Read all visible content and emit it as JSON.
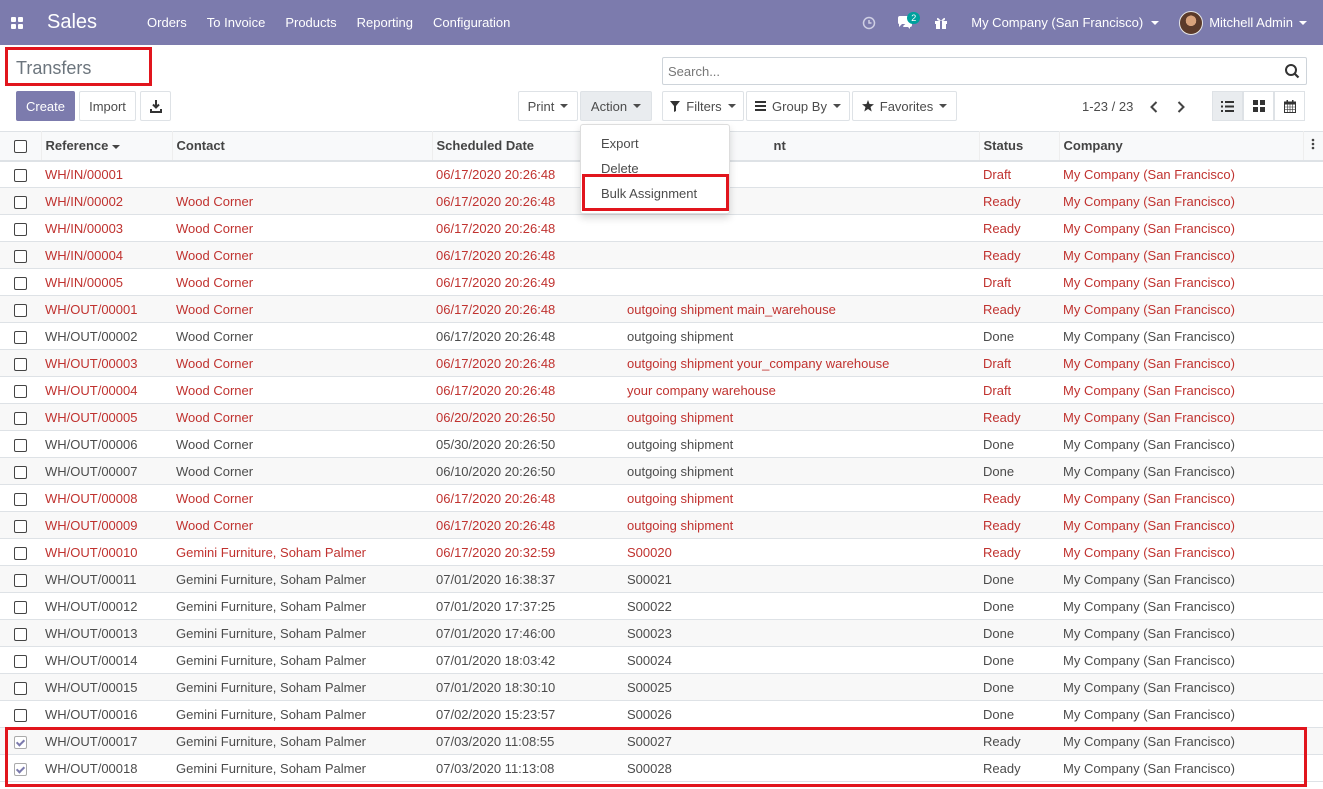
{
  "navbar": {
    "brand": "Sales",
    "menu": [
      "Orders",
      "To Invoice",
      "Products",
      "Reporting",
      "Configuration"
    ],
    "messages_badge": "2",
    "company": "My Company (San Francisco)",
    "user": "Mitchell Admin"
  },
  "control_panel": {
    "title": "Transfers",
    "create_label": "Create",
    "import_label": "Import",
    "print_label": "Print",
    "action_label": "Action",
    "filters_label": "Filters",
    "groupby_label": "Group By",
    "favorites_label": "Favorites",
    "search_placeholder": "Search...",
    "pager_value": "1-23 / 23"
  },
  "action_menu": {
    "items": [
      "Export",
      "Delete",
      "Bulk Assignment"
    ]
  },
  "table": {
    "headers": [
      "Reference",
      "Contact",
      "Scheduled Date",
      "Source Document",
      "Status",
      "Company"
    ],
    "header_overlap_visible": "nt",
    "rows": [
      {
        "ref": "WH/IN/00001",
        "contact": "",
        "date": "06/17/2020 20:26:48",
        "source": "",
        "status": "Draft",
        "company": "My Company (San Francisco)",
        "red": true,
        "checked": false
      },
      {
        "ref": "WH/IN/00002",
        "contact": "Wood Corner",
        "date": "06/17/2020 20:26:48",
        "source": "",
        "status": "Ready",
        "company": "My Company (San Francisco)",
        "red": true,
        "checked": false
      },
      {
        "ref": "WH/IN/00003",
        "contact": "Wood Corner",
        "date": "06/17/2020 20:26:48",
        "source": "",
        "status": "Ready",
        "company": "My Company (San Francisco)",
        "red": true,
        "checked": false
      },
      {
        "ref": "WH/IN/00004",
        "contact": "Wood Corner",
        "date": "06/17/2020 20:26:48",
        "source": "",
        "status": "Ready",
        "company": "My Company (San Francisco)",
        "red": true,
        "checked": false
      },
      {
        "ref": "WH/IN/00005",
        "contact": "Wood Corner",
        "date": "06/17/2020 20:26:49",
        "source": "",
        "status": "Draft",
        "company": "My Company (San Francisco)",
        "red": true,
        "checked": false
      },
      {
        "ref": "WH/OUT/00001",
        "contact": "Wood Corner",
        "date": "06/17/2020 20:26:48",
        "source": "outgoing shipment main_warehouse",
        "status": "Ready",
        "company": "My Company (San Francisco)",
        "red": true,
        "checked": false
      },
      {
        "ref": "WH/OUT/00002",
        "contact": "Wood Corner",
        "date": "06/17/2020 20:26:48",
        "source": "outgoing shipment",
        "status": "Done",
        "company": "My Company (San Francisco)",
        "red": false,
        "checked": false
      },
      {
        "ref": "WH/OUT/00003",
        "contact": "Wood Corner",
        "date": "06/17/2020 20:26:48",
        "source": "outgoing shipment your_company warehouse",
        "status": "Draft",
        "company": "My Company (San Francisco)",
        "red": true,
        "checked": false
      },
      {
        "ref": "WH/OUT/00004",
        "contact": "Wood Corner",
        "date": "06/17/2020 20:26:48",
        "source": "your company warehouse",
        "status": "Draft",
        "company": "My Company (San Francisco)",
        "red": true,
        "checked": false
      },
      {
        "ref": "WH/OUT/00005",
        "contact": "Wood Corner",
        "date": "06/20/2020 20:26:50",
        "source": "outgoing shipment",
        "status": "Ready",
        "company": "My Company (San Francisco)",
        "red": true,
        "checked": false
      },
      {
        "ref": "WH/OUT/00006",
        "contact": "Wood Corner",
        "date": "05/30/2020 20:26:50",
        "source": "outgoing shipment",
        "status": "Done",
        "company": "My Company (San Francisco)",
        "red": false,
        "checked": false
      },
      {
        "ref": "WH/OUT/00007",
        "contact": "Wood Corner",
        "date": "06/10/2020 20:26:50",
        "source": "outgoing shipment",
        "status": "Done",
        "company": "My Company (San Francisco)",
        "red": false,
        "checked": false
      },
      {
        "ref": "WH/OUT/00008",
        "contact": "Wood Corner",
        "date": "06/17/2020 20:26:48",
        "source": "outgoing shipment",
        "status": "Ready",
        "company": "My Company (San Francisco)",
        "red": true,
        "checked": false
      },
      {
        "ref": "WH/OUT/00009",
        "contact": "Wood Corner",
        "date": "06/17/2020 20:26:48",
        "source": "outgoing shipment",
        "status": "Ready",
        "company": "My Company (San Francisco)",
        "red": true,
        "checked": false
      },
      {
        "ref": "WH/OUT/00010",
        "contact": "Gemini Furniture, Soham Palmer",
        "date": "06/17/2020 20:32:59",
        "source": "S00020",
        "status": "Ready",
        "company": "My Company (San Francisco)",
        "red": true,
        "checked": false
      },
      {
        "ref": "WH/OUT/00011",
        "contact": "Gemini Furniture, Soham Palmer",
        "date": "07/01/2020 16:38:37",
        "source": "S00021",
        "status": "Done",
        "company": "My Company (San Francisco)",
        "red": false,
        "checked": false
      },
      {
        "ref": "WH/OUT/00012",
        "contact": "Gemini Furniture, Soham Palmer",
        "date": "07/01/2020 17:37:25",
        "source": "S00022",
        "status": "Done",
        "company": "My Company (San Francisco)",
        "red": false,
        "checked": false
      },
      {
        "ref": "WH/OUT/00013",
        "contact": "Gemini Furniture, Soham Palmer",
        "date": "07/01/2020 17:46:00",
        "source": "S00023",
        "status": "Done",
        "company": "My Company (San Francisco)",
        "red": false,
        "checked": false
      },
      {
        "ref": "WH/OUT/00014",
        "contact": "Gemini Furniture, Soham Palmer",
        "date": "07/01/2020 18:03:42",
        "source": "S00024",
        "status": "Done",
        "company": "My Company (San Francisco)",
        "red": false,
        "checked": false
      },
      {
        "ref": "WH/OUT/00015",
        "contact": "Gemini Furniture, Soham Palmer",
        "date": "07/01/2020 18:30:10",
        "source": "S00025",
        "status": "Done",
        "company": "My Company (San Francisco)",
        "red": false,
        "checked": false
      },
      {
        "ref": "WH/OUT/00016",
        "contact": "Gemini Furniture, Soham Palmer",
        "date": "07/02/2020 15:23:57",
        "source": "S00026",
        "status": "Done",
        "company": "My Company (San Francisco)",
        "red": false,
        "checked": false
      },
      {
        "ref": "WH/OUT/00017",
        "contact": "Gemini Furniture, Soham Palmer",
        "date": "07/03/2020 11:08:55",
        "source": "S00027",
        "status": "Ready",
        "company": "My Company (San Francisco)",
        "red": false,
        "checked": true
      },
      {
        "ref": "WH/OUT/00018",
        "contact": "Gemini Furniture, Soham Palmer",
        "date": "07/03/2020 11:13:08",
        "source": "S00028",
        "status": "Ready",
        "company": "My Company (San Francisco)",
        "red": false,
        "checked": true
      }
    ]
  },
  "colors": {
    "navbar": "#7c7bad",
    "highlight": "#e1151d",
    "late_text": "#c0322f"
  }
}
